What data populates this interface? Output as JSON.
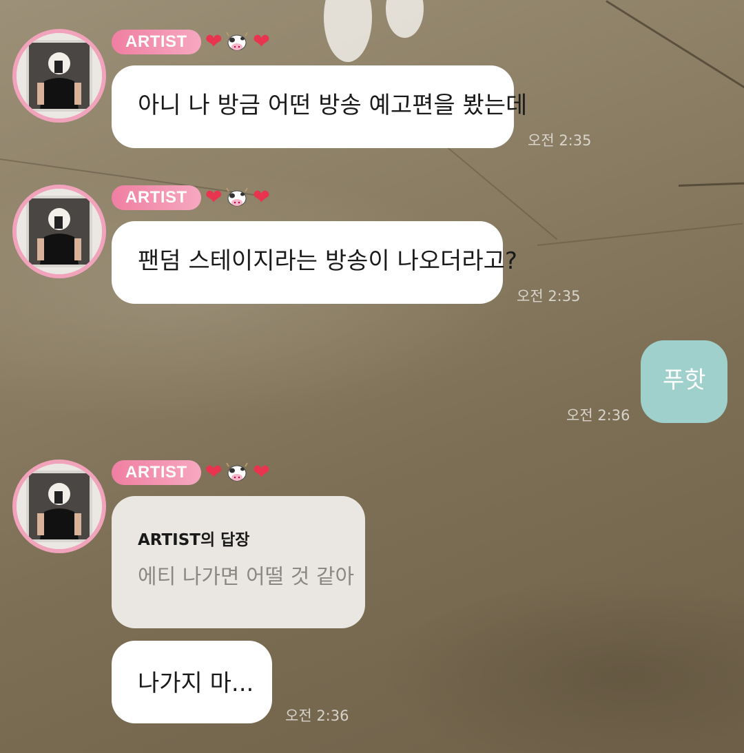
{
  "chat": {
    "sender_badge": "ARTIST",
    "reactions": [
      "❤",
      "cow-emoji",
      "❤"
    ],
    "messages": [
      {
        "text": "아니 나 방금 어떤 방송 예고편을 봤는데",
        "time": "오전 2:35"
      },
      {
        "text": "팬덤 스테이지라는 방송이 나오더라고?",
        "time": "오전 2:35"
      },
      {
        "text": "푸핫",
        "time": "오전 2:36"
      },
      {
        "reply_title": "ARTIST의 답장",
        "reply_quote": "에티 나가면 어떨 것 같아"
      },
      {
        "text": "나가지 마...",
        "time": "오전 2:36"
      }
    ]
  },
  "colors": {
    "badge": "#f07fa2",
    "avatar_ring": "#f1a3bc",
    "my_bubble": "#9fd0cb",
    "reply_bubble": "#eae6e1"
  }
}
